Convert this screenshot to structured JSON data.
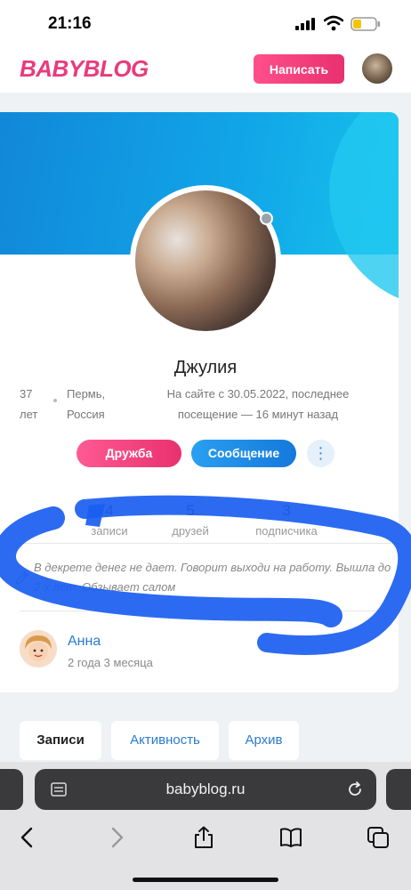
{
  "status_bar": {
    "time": "21:16"
  },
  "header": {
    "logo": "BABYBLOG",
    "write_label": "Написать"
  },
  "profile": {
    "name": "Джулия",
    "age_num": "37",
    "age_unit": "лет",
    "city": "Пермь,",
    "country": "Россия",
    "since": "На сайте с 30.05.2022, последнее посещение — 16 минут назад",
    "buttons": {
      "friendship": "Дружба",
      "message": "Сообщение",
      "more": "⋮"
    },
    "stats": [
      {
        "value": "4",
        "label": "записи"
      },
      {
        "value": "5",
        "label": "друзей"
      },
      {
        "value": "3",
        "label": "подписчика"
      }
    ],
    "status_text": "В декрете денег не дает. Говорит выходи на работу. Вышла до 2-х лет. Обзывает салом",
    "friend": {
      "name": "Анна",
      "time": "2 года 3 месяца"
    }
  },
  "tabs": [
    {
      "label": "Записи",
      "active": true
    },
    {
      "label": "Активность",
      "active": false
    },
    {
      "label": "Архив",
      "active": false
    }
  ],
  "browser": {
    "url": "babyblog.ru"
  },
  "colors": {
    "brand_pink": "#e8316e",
    "brand_blue": "#1479dc",
    "cover_blue": "#11a6e8",
    "scribble_blue": "#1a5ef0"
  }
}
